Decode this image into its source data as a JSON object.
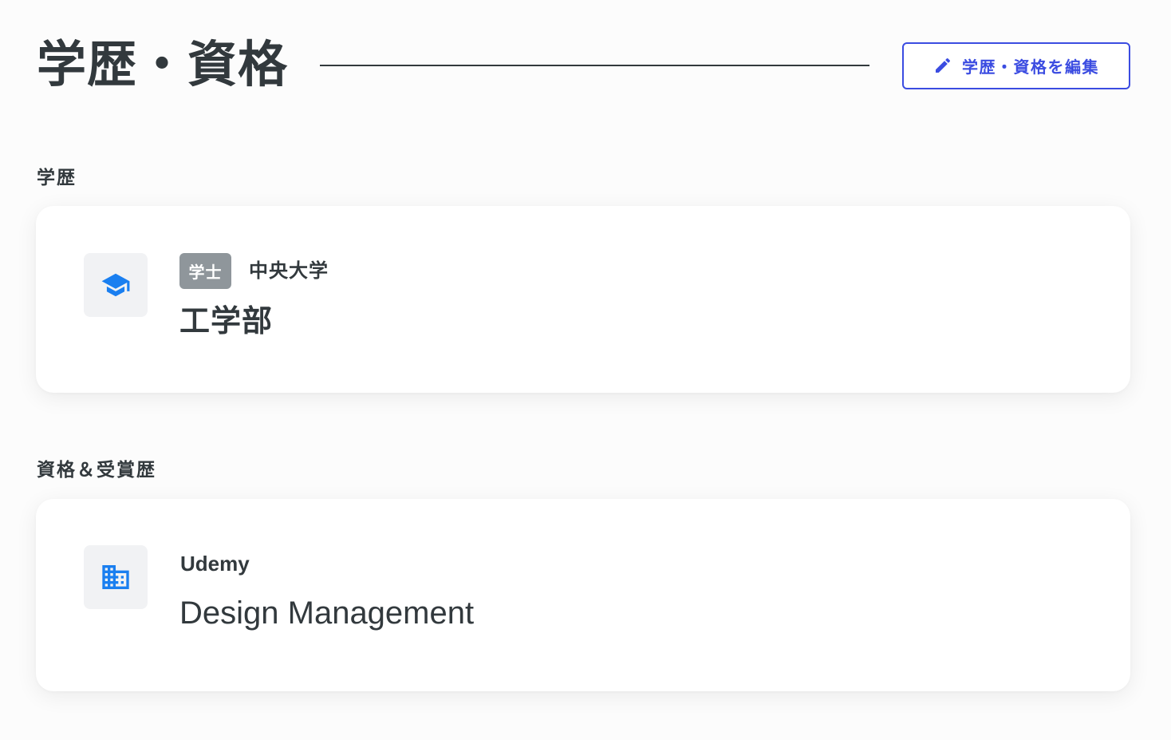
{
  "header": {
    "title": "学歴・資格",
    "edit_button_label": "学歴・資格を編集",
    "edit_button_icon": "pencil-icon"
  },
  "colors": {
    "accent": "#3b4ce1",
    "text": "#32393d",
    "icon": "#1a7ff0",
    "badge": "#8f969b",
    "icon_box": "#f1f2f4",
    "page_bg": "#fcfcfc",
    "card_bg": "#ffffff"
  },
  "education": {
    "section_label": "学歴",
    "items": [
      {
        "icon": "graduation-cap-icon",
        "degree_badge": "学士",
        "school": "中央大学",
        "faculty": "工学部"
      }
    ]
  },
  "certifications": {
    "section_label": "資格＆受賞歴",
    "items": [
      {
        "icon": "building-icon",
        "issuer": "Udemy",
        "name": "Design Management"
      }
    ]
  }
}
